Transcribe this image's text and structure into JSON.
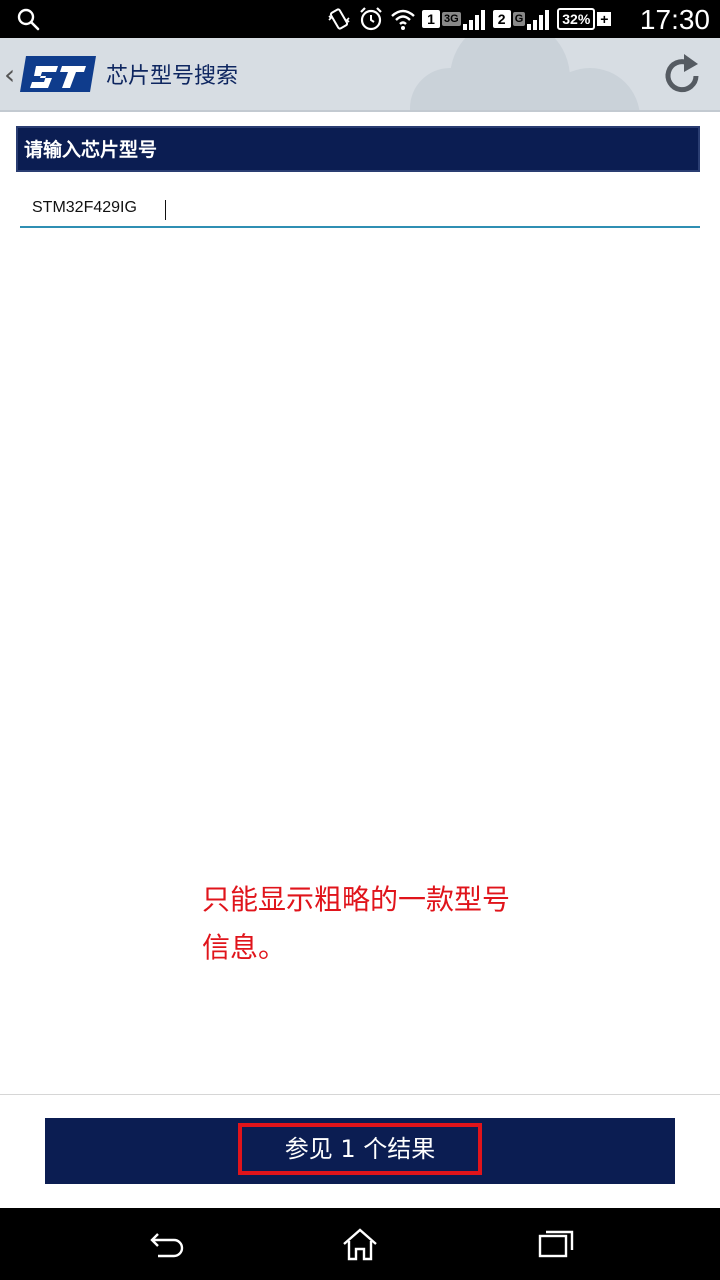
{
  "status_bar": {
    "time": "17:30",
    "battery": "32%",
    "sim1": "1",
    "sim1_network": "3G",
    "sim2": "2",
    "sim2_network": "G"
  },
  "action_bar": {
    "title": "芯片型号搜索",
    "back_glyph": "‹"
  },
  "search": {
    "header": "请输入芯片型号",
    "value": "STM32F429IG"
  },
  "annotation": {
    "line1": "只能显示粗略的一款型号",
    "line2": "信息。"
  },
  "result_button": {
    "label": "参见 1 个结果"
  },
  "colors": {
    "navy": "#0b1d52",
    "highlight_red": "#e0141b",
    "input_underline": "#2f8fb3"
  },
  "icons": [
    "search-icon",
    "vibrate-icon",
    "alarm-icon",
    "wifi-icon",
    "signal-icon",
    "battery-icon",
    "back-icon",
    "st-logo",
    "refresh-icon",
    "nav-back-icon",
    "nav-home-icon",
    "nav-recents-icon"
  ]
}
